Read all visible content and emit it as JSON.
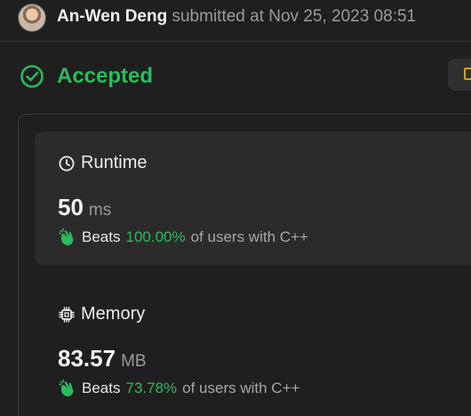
{
  "submission": {
    "author": "An-Wen Deng",
    "submitted_text": "submitted at Nov 25, 2023 08:51"
  },
  "status": {
    "label": "Accepted",
    "color": "#2cbb5d",
    "icon": "check-circle-icon"
  },
  "runtime": {
    "title": "Runtime",
    "icon": "clock-icon",
    "value": "50",
    "unit": "ms",
    "beats_word": "Beats",
    "beats_pct": "100.00%",
    "beats_rest": "of users with C++",
    "beats_icon": "clapping-hands-icon"
  },
  "memory": {
    "title": "Memory",
    "icon": "chip-icon",
    "value": "83.57",
    "unit": "MB",
    "beats_word": "Beats",
    "beats_pct": "73.78%",
    "beats_rest": "of users with C++",
    "beats_icon": "clapping-hands-icon"
  },
  "colors": {
    "accent_green": "#2cbb5d",
    "card_bg": "#2b2b2b",
    "page_bg": "#1f1f1f",
    "button_glyph": "#d89a2a"
  }
}
